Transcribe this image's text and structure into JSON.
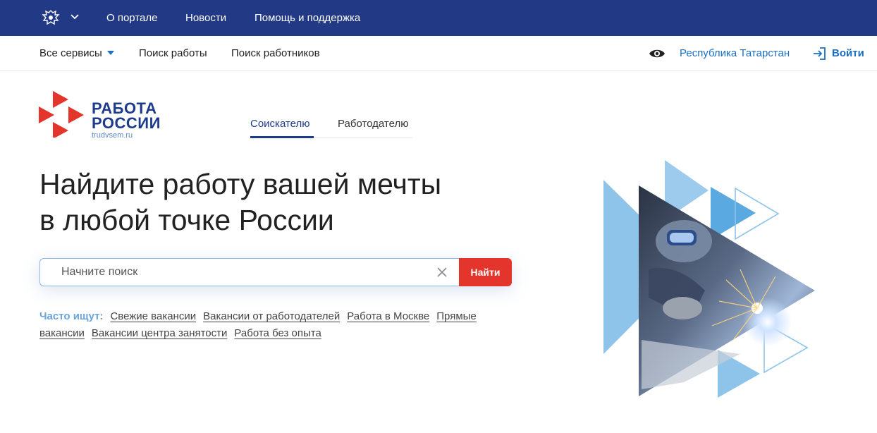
{
  "gov_bar": {
    "links": [
      "О портале",
      "Новости",
      "Помощь и поддержка"
    ],
    "emblem_icon": "coat-of-arms-icon",
    "color": "#223a85"
  },
  "nav": {
    "all_services": "Все сервисы",
    "job_search": "Поиск работы",
    "employee_search": "Поиск работников",
    "region": "Республика Татарстан",
    "login": "Войти",
    "accent": "#1c6ec0"
  },
  "logo": {
    "line1": "РАБОТА",
    "line2": "РОССИИ",
    "url": "trudvsem.ru"
  },
  "tabs": {
    "seeker": "Соискателю",
    "employer": "Работодателю",
    "active": "seeker"
  },
  "hero": {
    "line1": "Найдите работу вашей мечты",
    "line2": "в любой точке России"
  },
  "search": {
    "placeholder": "Начните поиск",
    "button": "Найти",
    "button_color": "#e3352b"
  },
  "popular": {
    "label": "Часто ищут:",
    "links": [
      "Свежие вакансии",
      "Вакансии от работодателей",
      "Работа в Москве",
      "Прямые вакансии",
      "Вакансии центра занятости",
      "Работа без опыта"
    ]
  }
}
